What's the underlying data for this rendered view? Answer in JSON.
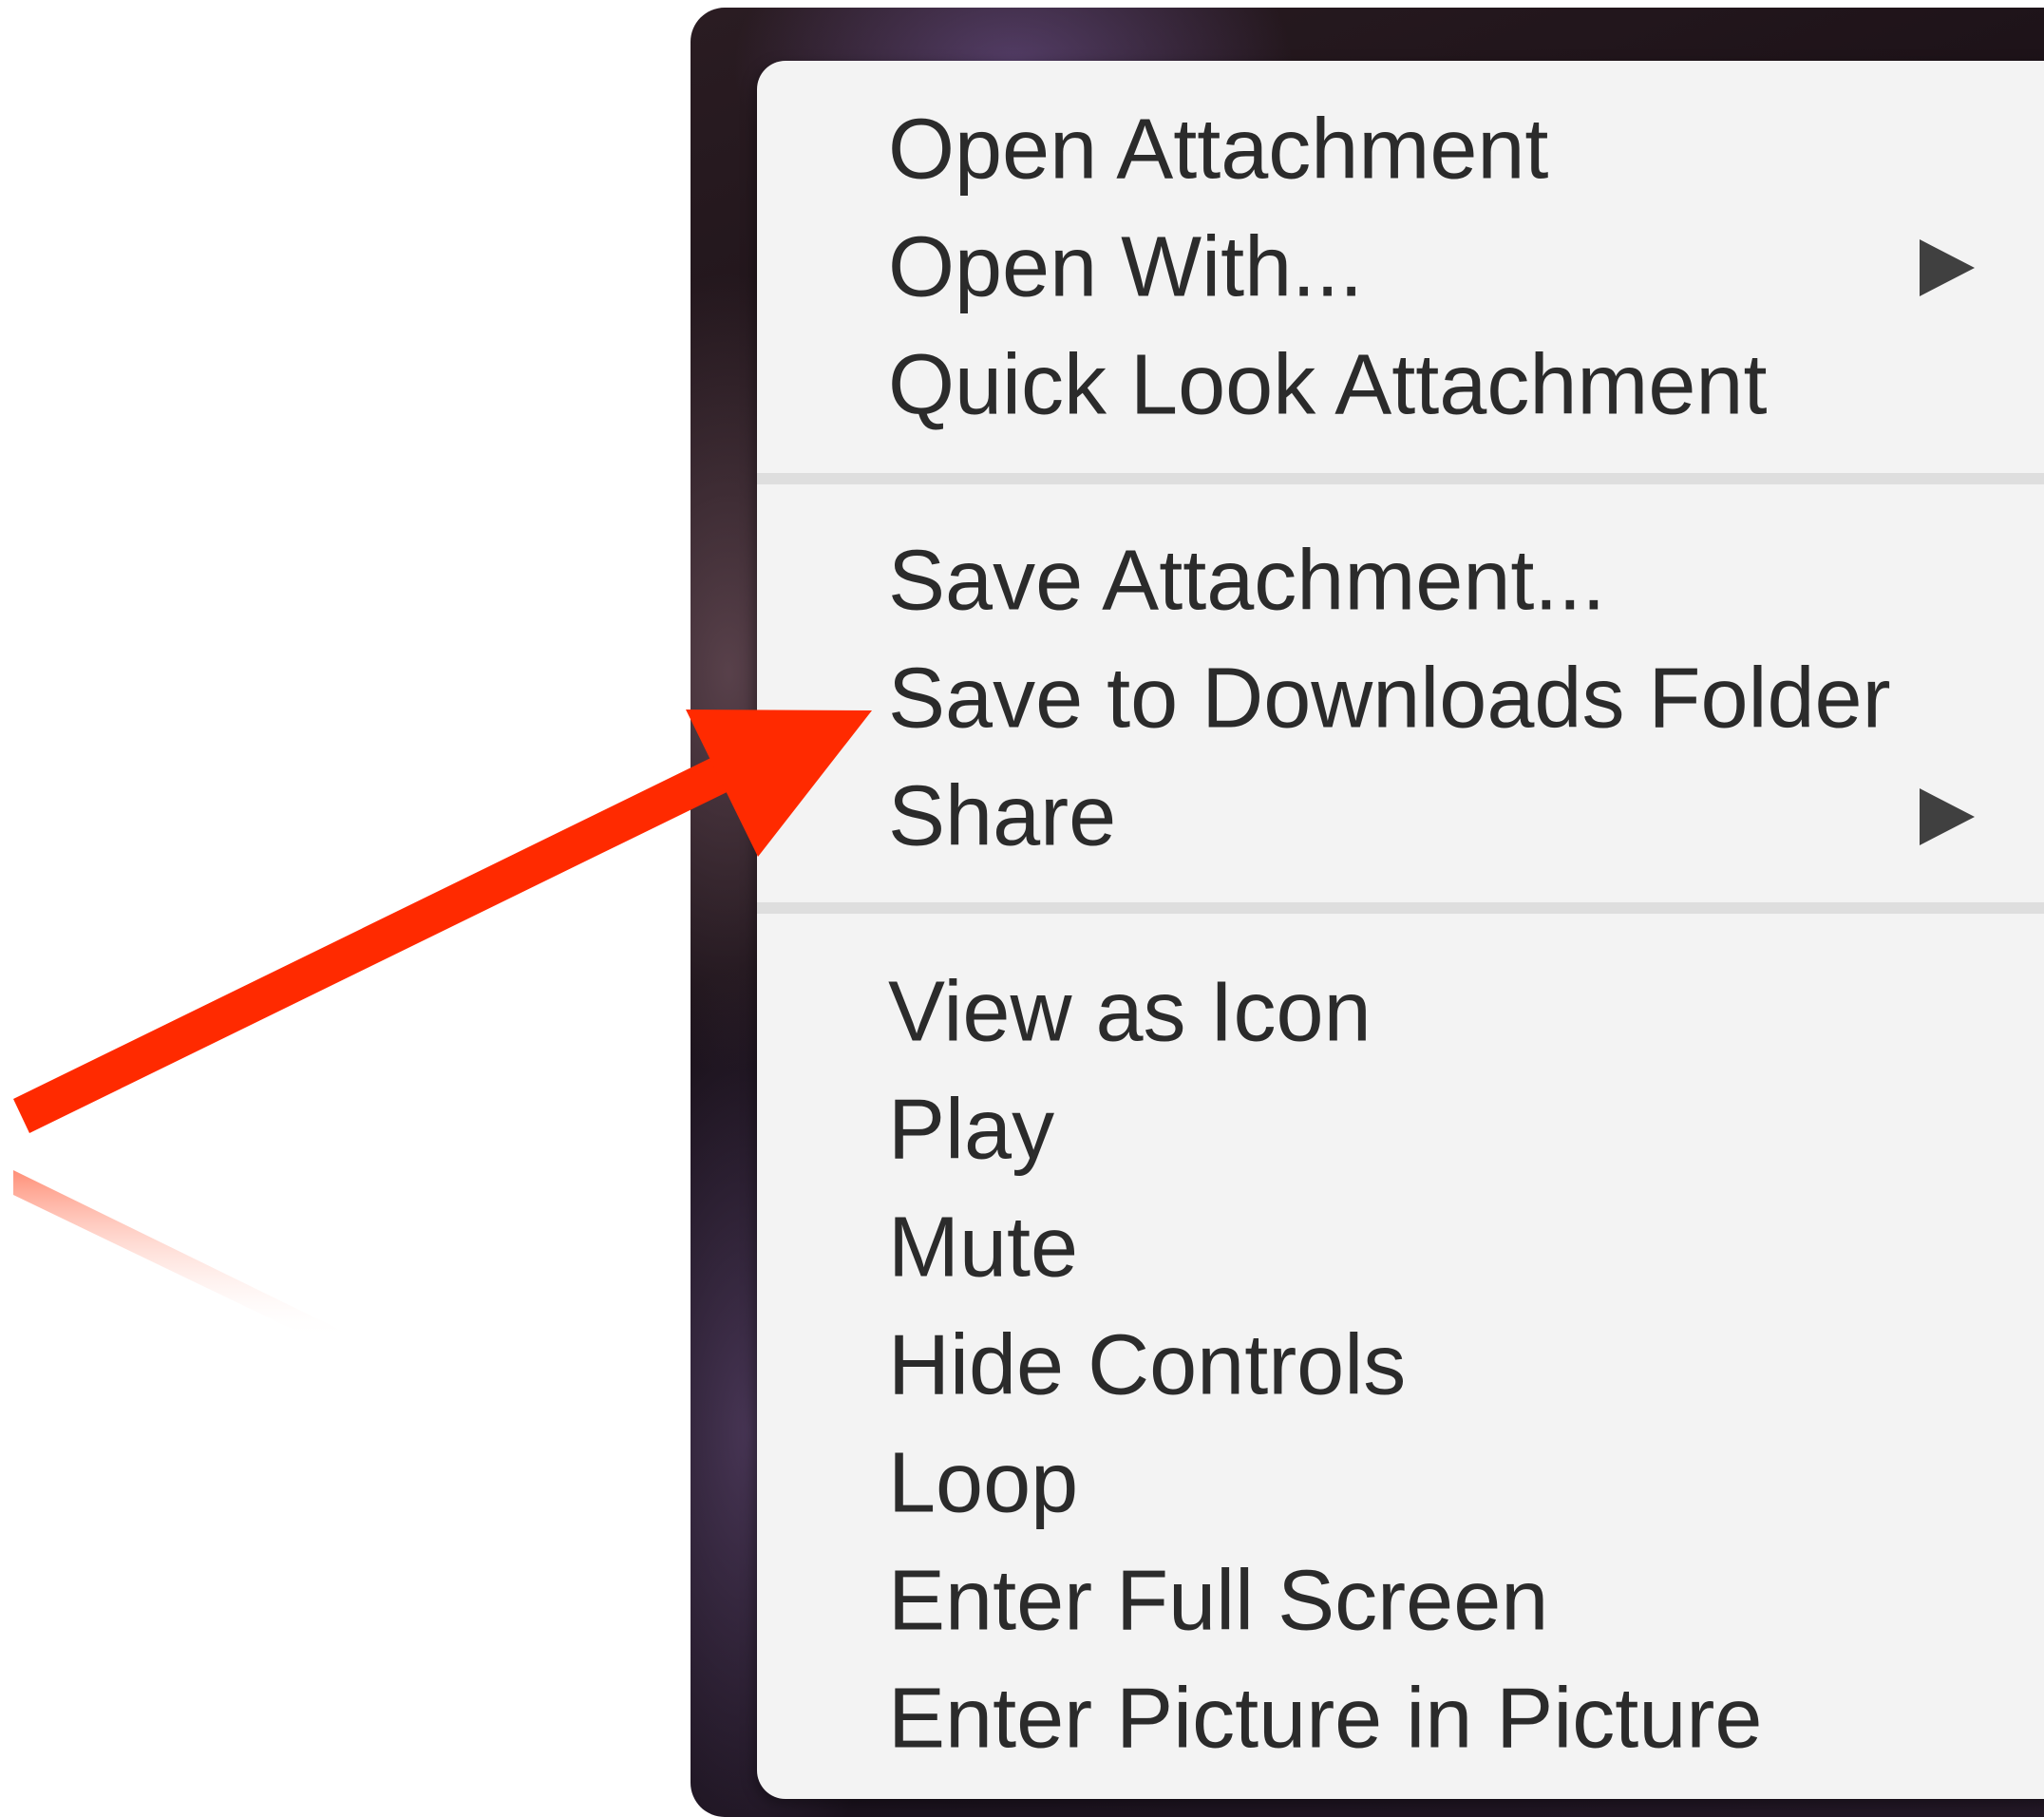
{
  "context_menu": {
    "groups": [
      {
        "items": [
          {
            "label": "Open Attachment",
            "has_submenu": false
          },
          {
            "label": "Open With...",
            "has_submenu": true
          },
          {
            "label": "Quick Look Attachment",
            "has_submenu": false
          }
        ]
      },
      {
        "items": [
          {
            "label": "Save Attachment...",
            "has_submenu": false
          },
          {
            "label": "Save to Downloads Folder",
            "has_submenu": false
          },
          {
            "label": "Share",
            "has_submenu": true
          }
        ]
      },
      {
        "items": [
          {
            "label": "View as Icon",
            "has_submenu": false
          },
          {
            "label": "Play",
            "has_submenu": false
          },
          {
            "label": "Mute",
            "has_submenu": false
          },
          {
            "label": "Hide Controls",
            "has_submenu": false
          },
          {
            "label": "Loop",
            "has_submenu": false
          },
          {
            "label": "Enter Full Screen",
            "has_submenu": false
          },
          {
            "label": "Enter Picture in Picture",
            "has_submenu": false
          }
        ]
      }
    ]
  },
  "annotation": {
    "arrow_color": "#ff2a00",
    "points_to": "Save to Downloads Folder"
  },
  "colors": {
    "menu_background": "#f3f3f3",
    "menu_text": "#2b2b2b",
    "separator": "#dedede"
  }
}
